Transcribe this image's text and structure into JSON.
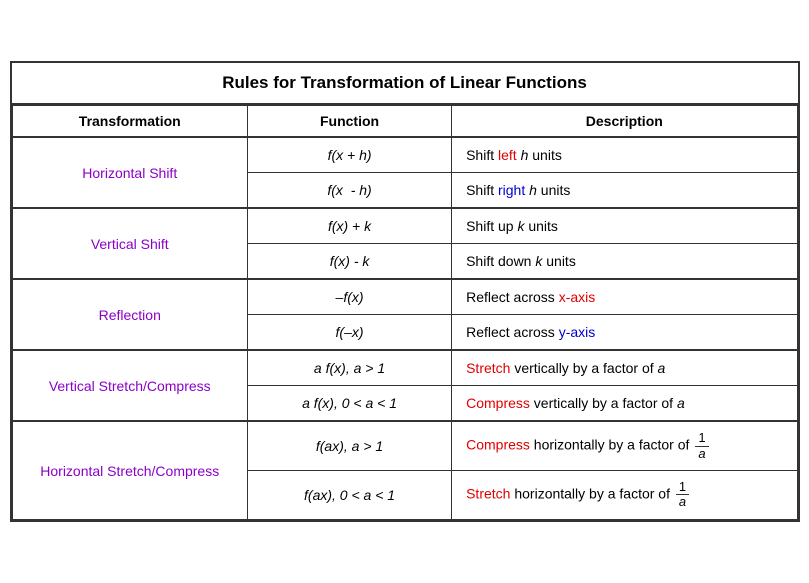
{
  "title": "Rules for Transformation of Linear Functions",
  "headers": [
    "Transformation",
    "Function",
    "Description"
  ],
  "rows": [
    {
      "transform": "Horizontal Shift",
      "rowspan": 2,
      "functions": [
        "f(x + h)",
        "f(x  - h)"
      ],
      "descriptions": [
        {
          "parts": [
            {
              "text": "Shift ",
              "style": ""
            },
            {
              "text": "left",
              "style": "color-red"
            },
            {
              "text": " h units",
              "style": "italic-plain"
            }
          ]
        },
        {
          "parts": [
            {
              "text": "Shift ",
              "style": ""
            },
            {
              "text": "right",
              "style": "color-blue"
            },
            {
              "text": " h units",
              "style": "italic-plain"
            }
          ]
        }
      ]
    },
    {
      "transform": "Vertical Shift",
      "rowspan": 2,
      "functions": [
        "f(x) + k",
        "f(x) - k"
      ],
      "descriptions": [
        {
          "parts": [
            {
              "text": "Shift ",
              "style": ""
            },
            {
              "text": "up",
              "style": ""
            },
            {
              "text": " k units",
              "style": "italic-plain"
            }
          ]
        },
        {
          "parts": [
            {
              "text": "Shift ",
              "style": ""
            },
            {
              "text": "down",
              "style": ""
            },
            {
              "text": " k units",
              "style": "italic-plain"
            }
          ]
        }
      ]
    },
    {
      "transform": "Reflection",
      "rowspan": 2,
      "functions": [
        "–f(x)",
        "f(–x)"
      ],
      "descriptions": [
        {
          "parts": [
            {
              "text": "Reflect across ",
              "style": ""
            },
            {
              "text": "x-axis",
              "style": "color-red"
            }
          ]
        },
        {
          "parts": [
            {
              "text": "Reflect across ",
              "style": ""
            },
            {
              "text": "y-axis",
              "style": "color-blue"
            }
          ]
        }
      ]
    },
    {
      "transform": "Vertical Stretch/Compress",
      "rowspan": 2,
      "functions": [
        "a f(x), a > 1",
        "a f(x), 0 < a < 1"
      ],
      "descriptions": [
        {
          "parts": [
            {
              "text": "Stretch",
              "style": "color-red"
            },
            {
              "text": " vertically by a factor of ",
              "style": ""
            },
            {
              "text": "a",
              "style": "italic-plain"
            }
          ]
        },
        {
          "parts": [
            {
              "text": "Compress",
              "style": "color-red"
            },
            {
              "text": " vertically by a factor of ",
              "style": ""
            },
            {
              "text": "a",
              "style": "italic-plain"
            }
          ]
        }
      ]
    },
    {
      "transform": "Horizontal Stretch/Compress",
      "rowspan": 2,
      "functions": [
        "f(ax), a > 1",
        "f(ax), 0 < a < 1"
      ],
      "descriptions": [
        {
          "type": "fraction",
          "before": "Compress",
          "middle": " horizontally by a factor of ",
          "num": "1",
          "den": "a"
        },
        {
          "type": "fraction",
          "before": "Stretch",
          "middle": " horizontally by a factor of ",
          "num": "1",
          "den": "a"
        }
      ]
    }
  ]
}
